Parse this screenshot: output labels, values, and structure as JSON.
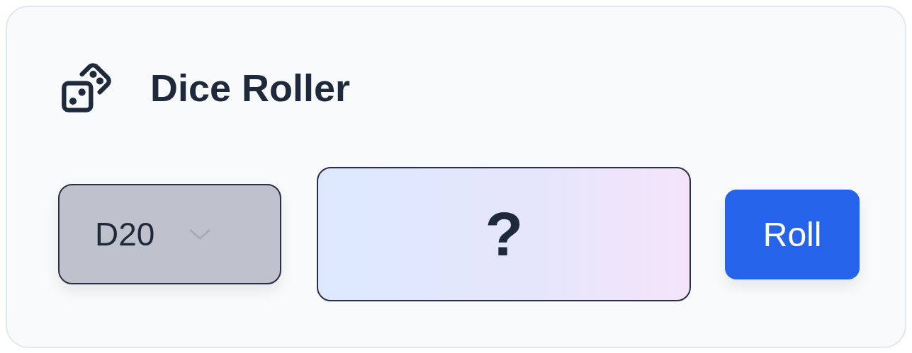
{
  "card": {
    "title": "Dice Roller"
  },
  "die_select": {
    "value": "D20",
    "disabled": true
  },
  "result": {
    "value": "?"
  },
  "roll_button": {
    "label": "Roll"
  }
}
